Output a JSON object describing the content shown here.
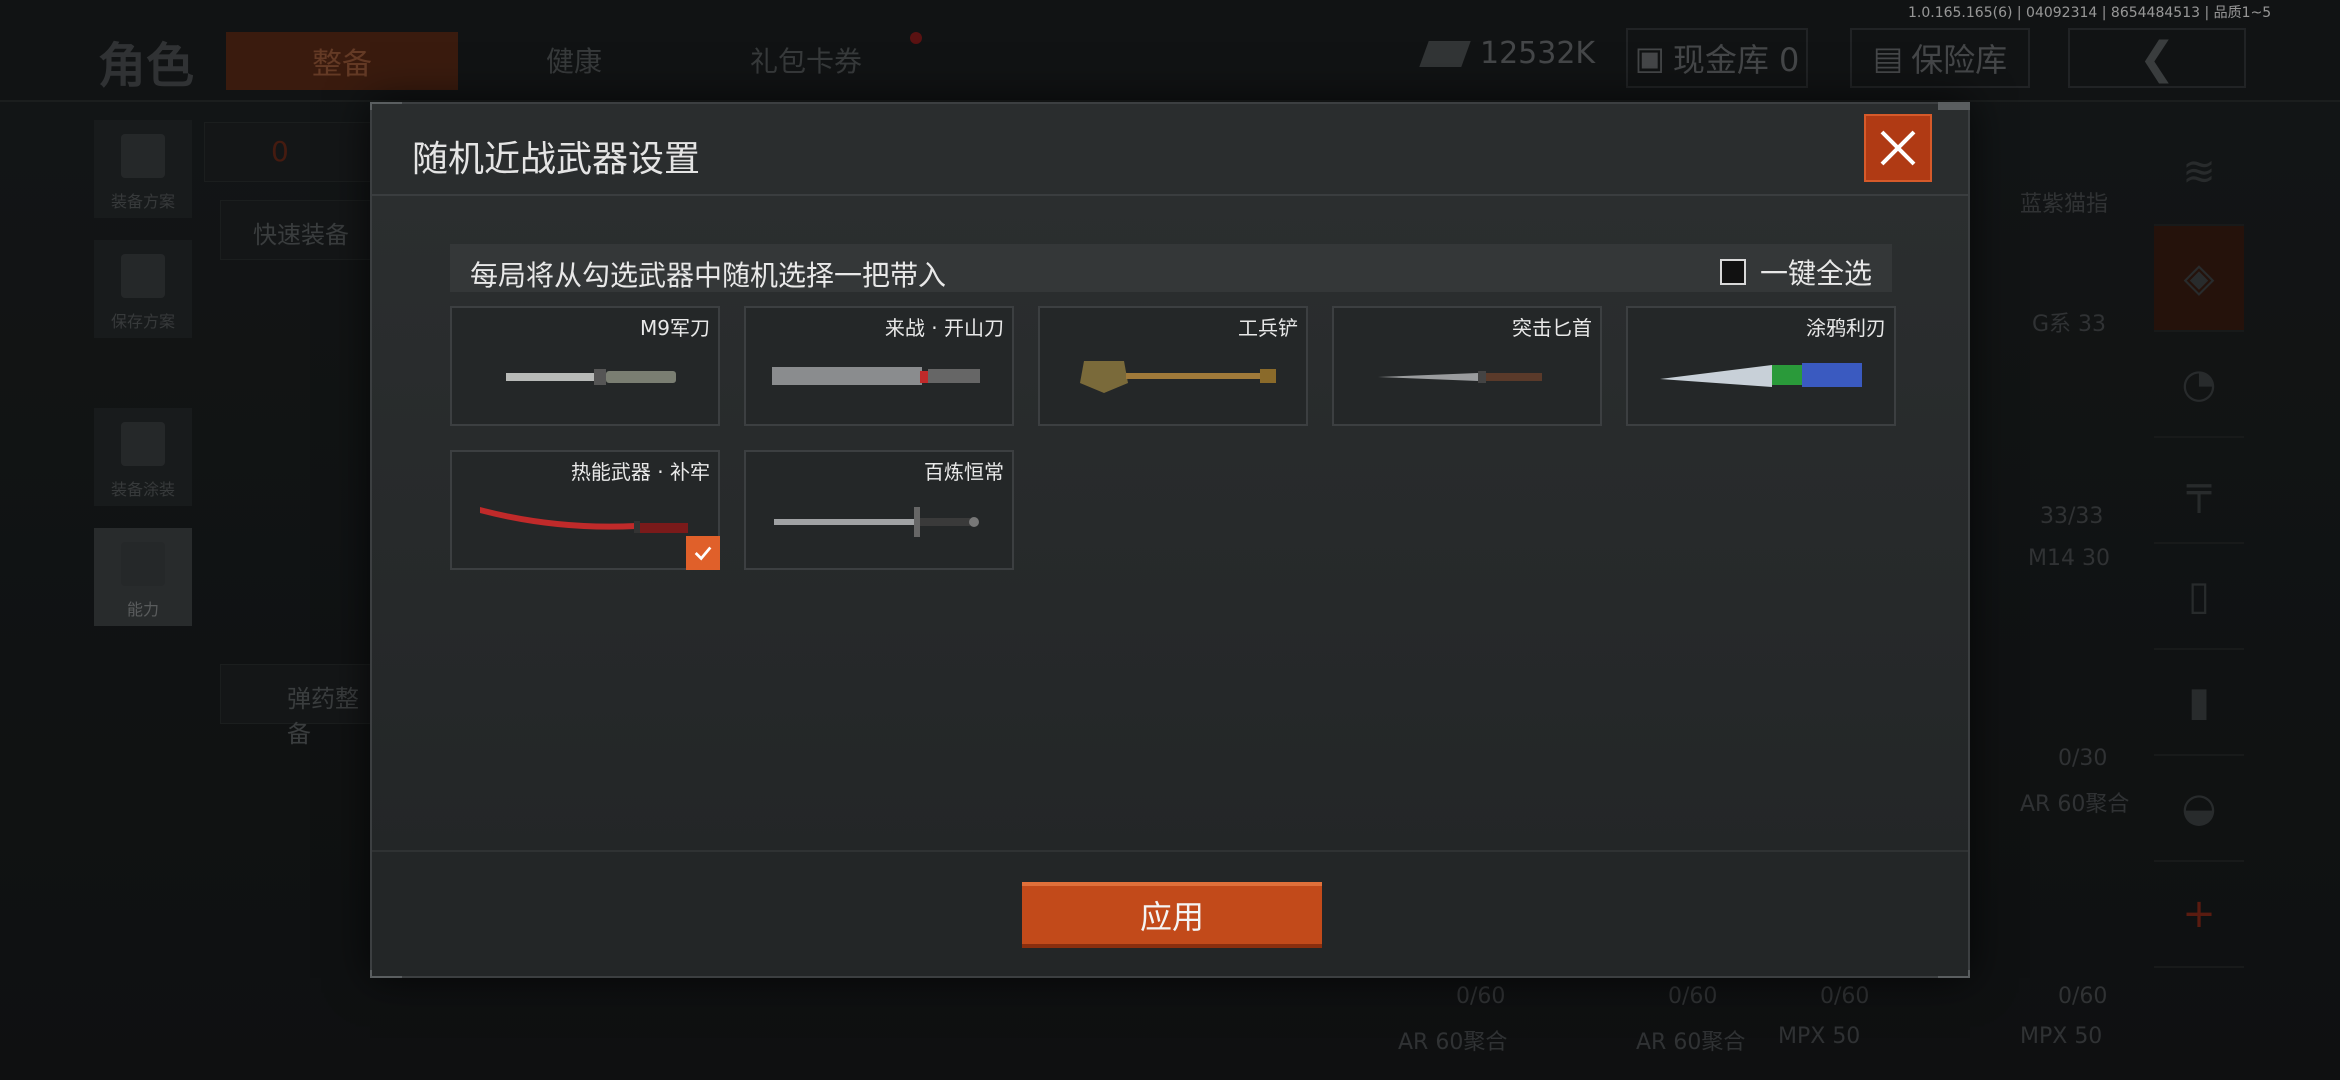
{
  "version": "1.0.165.165(6) | 04092314 | 8654484513 | 品质1~5",
  "topbar": {
    "title": "角色",
    "tabs": [
      "整备",
      "健康",
      "礼包卡券"
    ],
    "money": "12532K",
    "cash_vault": "现金库 0",
    "safe_vault": "保险库"
  },
  "left_menu": [
    "装备方案",
    "保存方案",
    "装备涂装",
    "能力"
  ],
  "background": {
    "armor_count": "0",
    "quick_equip": "快速装备",
    "ammo_sort": "弹药整备",
    "items": [
      "G系 33",
      "33/33",
      "M14 30",
      "0/30",
      "AR 60聚合",
      "0/60",
      "0/60",
      "0/60",
      "0/60",
      "AR 60聚合",
      "AR 60聚合",
      "MPX 50",
      "MPX 50",
      "蓝紫猫指"
    ]
  },
  "modal": {
    "title": "随机近战武器设置",
    "info": "每局将从勾选武器中随机选择一把带入",
    "select_all": "一键全选",
    "apply": "应用",
    "weapons": [
      {
        "name": "M9军刀",
        "checked": false,
        "color": "#7a7e72"
      },
      {
        "name": "来战 · 开山刀",
        "checked": false,
        "color": "#8a8c8e"
      },
      {
        "name": "工兵铲",
        "checked": false,
        "color": "#7a6a3a"
      },
      {
        "name": "突击匕首",
        "checked": false,
        "color": "#9a9c9e"
      },
      {
        "name": "涂鸦利刃",
        "checked": false,
        "color": "#3a5ac0"
      },
      {
        "name": "热能武器 · 补牢",
        "checked": true,
        "color": "#c02a2a"
      },
      {
        "name": "百炼恒常",
        "checked": false,
        "color": "#a0a2a4"
      }
    ]
  },
  "colors": {
    "accent": "#c24a1a",
    "checkmark": "#e0602a"
  }
}
